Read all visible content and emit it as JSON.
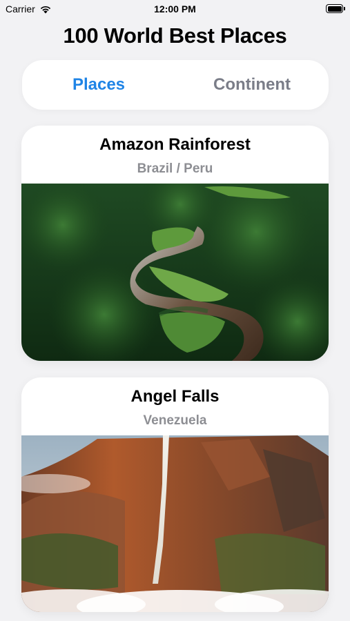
{
  "status_bar": {
    "carrier": "Carrier",
    "time": "12:00 PM",
    "wifi_icon": "wifi-icon",
    "battery_icon": "battery-icon",
    "battery_level": 1.0
  },
  "header": {
    "title": "100 World Best Places"
  },
  "tabs": [
    {
      "label": "Places",
      "selected": true
    },
    {
      "label": "Continent",
      "selected": false
    }
  ],
  "places": [
    {
      "name": "Amazon Rainforest",
      "location": "Brazil / Peru",
      "image": "aerial view of river through rainforest"
    },
    {
      "name": "Angel Falls",
      "location": "Venezuela",
      "image": "waterfall over red cliff"
    }
  ],
  "colors": {
    "accent": "#1f84e6",
    "inactive_tab": "#7a7d88",
    "subtitle": "#8d8e93",
    "background": "#f2f2f4"
  }
}
